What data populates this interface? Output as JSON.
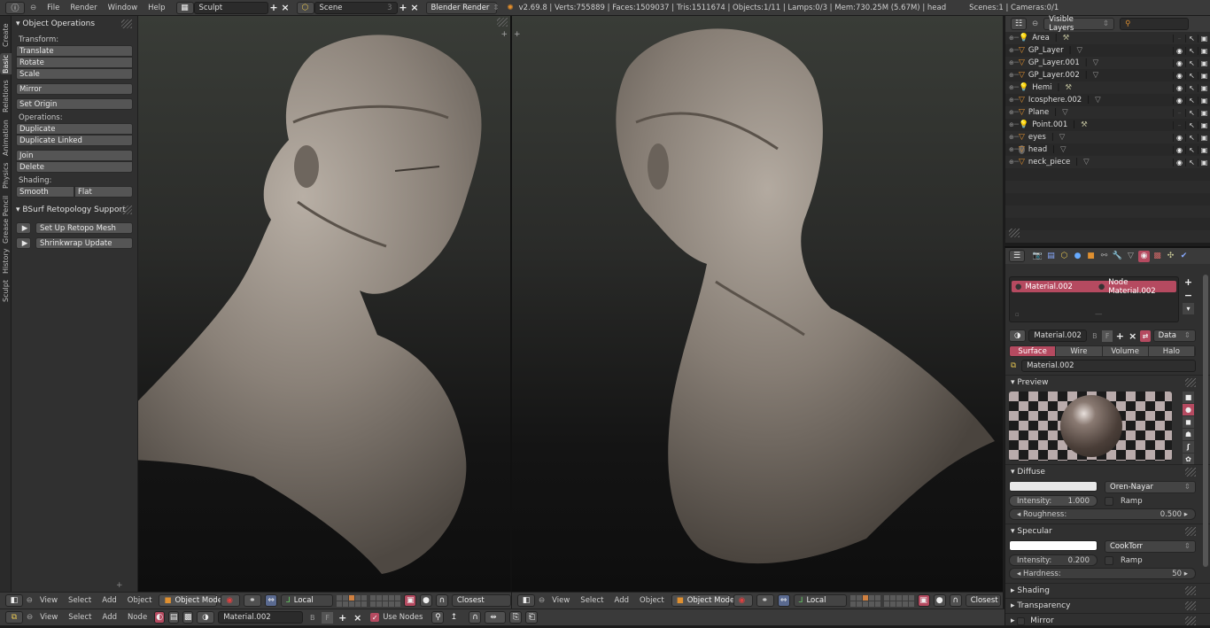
{
  "topbar": {
    "menus": [
      "File",
      "Render",
      "Window",
      "Help"
    ],
    "screen_layout": "Sculpt",
    "scene": "Scene",
    "scene_users": "3",
    "render_engine": "Blender Render",
    "stats": "v2.69.8 | Verts:755889 | Faces:1509037 | Tris:1511674 | Objects:1/11 | Lamps:0/3 | Mem:730.25M (5.67M) | head",
    "scene_stats": "Scenes:1 | Cameras:0/1",
    "icons": [
      "info-editor-icon",
      "layout-icon",
      "scene-icon",
      "blender-logo-icon"
    ]
  },
  "tool_tabs": [
    "Create",
    "Basic",
    "Relations",
    "Animation",
    "Physics",
    "Grease Pencil",
    "History",
    "Sculpt"
  ],
  "tool_tabs_active": "Basic",
  "toolshelf": {
    "object_ops_title": "Object Operations",
    "transform_label": "Transform:",
    "transform_buttons": [
      "Translate",
      "Rotate",
      "Scale"
    ],
    "mirror": "Mirror",
    "set_origin": "Set Origin",
    "operations_label": "Operations:",
    "operations_buttons": [
      "Duplicate",
      "Duplicate Linked"
    ],
    "join": "Join",
    "delete": "Delete",
    "shading_label": "Shading:",
    "smooth": "Smooth",
    "flat": "Flat",
    "bsurf_title": "BSurf Retopology Support",
    "bsurf_buttons": [
      "Set Up Retopo Mesh",
      "Shrinkwrap Update"
    ]
  },
  "viewport_header": {
    "menus": [
      "View",
      "Select",
      "Add",
      "Object"
    ],
    "mode": "Object Mode",
    "orientation": "Local",
    "snap": "Closest"
  },
  "node_header": {
    "menus": [
      "View",
      "Select",
      "Add",
      "Node"
    ],
    "material": "Material.002",
    "users_b": "B",
    "users_f": "F",
    "use_nodes_label": "Use Nodes",
    "use_nodes": true
  },
  "outliner": {
    "filter": "Visible Layers",
    "items": [
      {
        "name": "Area",
        "type": "lamp",
        "visible": false
      },
      {
        "name": "GP_Layer",
        "type": "mesh",
        "visible": true
      },
      {
        "name": "GP_Layer.001",
        "type": "mesh",
        "visible": true
      },
      {
        "name": "GP_Layer.002",
        "type": "mesh",
        "visible": true
      },
      {
        "name": "Hemi",
        "type": "lamp",
        "visible": true
      },
      {
        "name": "Icosphere.002",
        "type": "mesh",
        "visible": true
      },
      {
        "name": "Plane",
        "type": "mesh",
        "visible": false
      },
      {
        "name": "Point.001",
        "type": "lamp",
        "visible": false
      },
      {
        "name": "eyes",
        "type": "mesh",
        "visible": true
      },
      {
        "name": "head",
        "type": "mesh",
        "visible": true,
        "selected": true
      },
      {
        "name": "neck_piece",
        "type": "mesh",
        "visible": true
      }
    ]
  },
  "properties": {
    "slots": [
      "Material.002",
      "Node Material.002"
    ],
    "material_name": "Material.002",
    "users_b": "B",
    "users_f": "F",
    "link": "Data",
    "tabs": [
      "Surface",
      "Wire",
      "Volume",
      "Halo"
    ],
    "active_tab": "Surface",
    "node_material": "Material.002",
    "preview_title": "Preview",
    "diffuse": {
      "title": "Diffuse",
      "color": "#e8e8e8",
      "shader": "Oren-Nayar",
      "intensity_label": "Intensity:",
      "intensity": "1.000",
      "ramp": "Ramp",
      "roughness_label": "Roughness:",
      "roughness": "0.500"
    },
    "specular": {
      "title": "Specular",
      "color": "#ffffff",
      "shader": "CookTorr",
      "intensity_label": "Intensity:",
      "intensity": "0.200",
      "ramp": "Ramp",
      "hardness_label": "Hardness:",
      "hardness": "50"
    },
    "collapsed_sections": [
      "Shading",
      "Transparency",
      "Mirror"
    ]
  },
  "colors": {
    "accent": "#b54a60",
    "panel": "#303030",
    "header": "#3a3a3a"
  }
}
